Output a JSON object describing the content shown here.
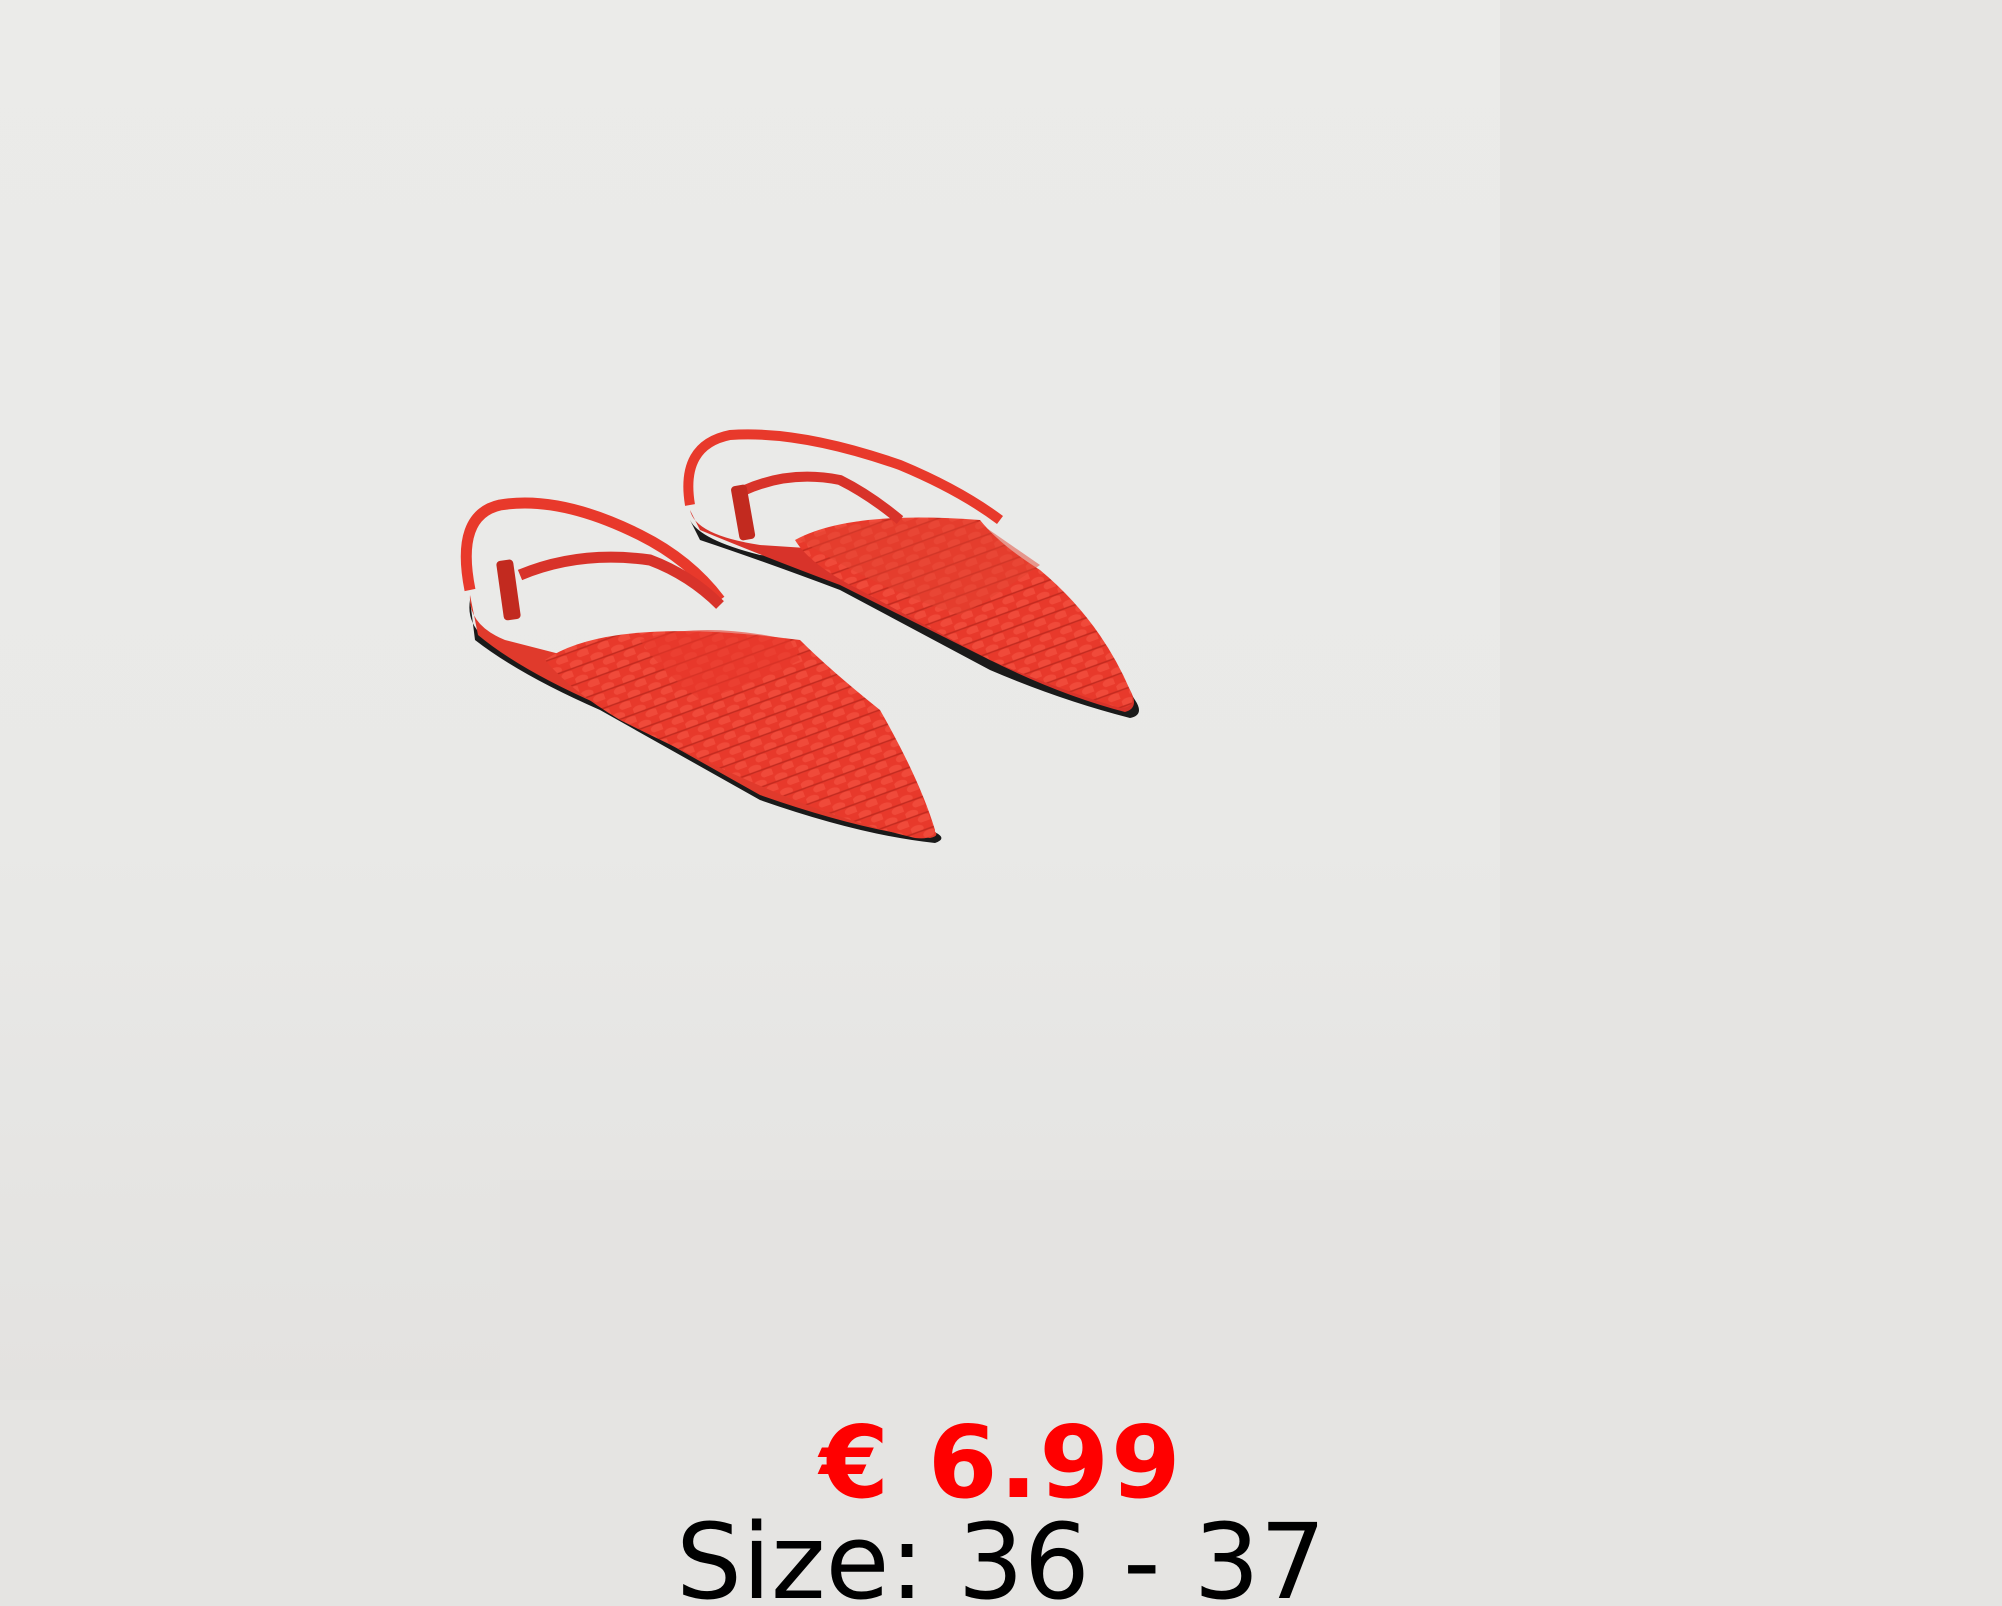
{
  "colors": {
    "price": "#ff0000",
    "size_text": "#000000",
    "shoe": "#e8392b",
    "background": "#e5e4e2"
  },
  "product": {
    "image_icon": "red-woven-slingback-flats",
    "price": "€ 6.99",
    "size": "Size: 36 - 37"
  }
}
